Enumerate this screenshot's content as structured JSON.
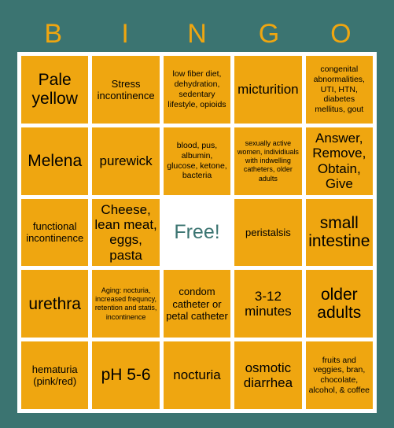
{
  "card": {
    "title": "BINGO",
    "background_color": "#3b7471",
    "cell_color": "#efa610",
    "frame_color": "#ffffff",
    "free_text_color": "#3b7471",
    "header_letters": [
      "B",
      "I",
      "N",
      "G",
      "O"
    ],
    "rows": [
      [
        {
          "text": "Pale yellow",
          "size": "xl",
          "free": false
        },
        {
          "text": "Stress incontinence",
          "size": "md",
          "free": false
        },
        {
          "text": "low fiber diet, dehydration, sedentary lifestyle, opioids",
          "size": "sm",
          "free": false
        },
        {
          "text": "micturition",
          "size": "lg",
          "free": false
        },
        {
          "text": "congenital abnormalities, UTI, HTN, diabetes mellitus, gout",
          "size": "sm",
          "free": false
        }
      ],
      [
        {
          "text": "Melena",
          "size": "xl",
          "free": false
        },
        {
          "text": "purewick",
          "size": "lg",
          "free": false
        },
        {
          "text": "blood, pus, albumin, glucose, ketone, bacteria",
          "size": "sm",
          "free": false
        },
        {
          "text": "sexually active women, individiuals with indwelling catheters, older adults",
          "size": "xs",
          "free": false
        },
        {
          "text": "Answer, Remove, Obtain, Give",
          "size": "lg",
          "free": false
        }
      ],
      [
        {
          "text": "functional incontinence",
          "size": "md",
          "free": false
        },
        {
          "text": "Cheese, lean meat, eggs, pasta",
          "size": "lg",
          "free": false
        },
        {
          "text": "Free!",
          "size": "xl",
          "free": true
        },
        {
          "text": "peristalsis",
          "size": "md",
          "free": false
        },
        {
          "text": "small intestine",
          "size": "xl",
          "free": false
        }
      ],
      [
        {
          "text": "urethra",
          "size": "xl",
          "free": false
        },
        {
          "text": "Aging: nocturia, increased frequncy, retention and statis, incontinence",
          "size": "xs",
          "free": false
        },
        {
          "text": "condom catheter or petal catheter",
          "size": "md",
          "free": false
        },
        {
          "text": "3-12 minutes",
          "size": "lg",
          "free": false
        },
        {
          "text": "older adults",
          "size": "xl",
          "free": false
        }
      ],
      [
        {
          "text": "hematuria (pink/red)",
          "size": "md",
          "free": false
        },
        {
          "text": "pH 5-6",
          "size": "xl",
          "free": false
        },
        {
          "text": "nocturia",
          "size": "lg",
          "free": false
        },
        {
          "text": "osmotic diarrhea",
          "size": "lg",
          "free": false
        },
        {
          "text": "fruits and veggies, bran, chocolate, alcohol, & coffee",
          "size": "sm",
          "free": false
        }
      ]
    ]
  }
}
